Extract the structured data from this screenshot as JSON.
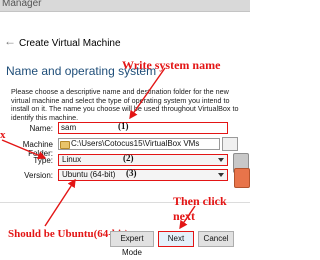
{
  "window": {
    "caption": "Manager"
  },
  "dialog": {
    "title": "Create Virtual Machine",
    "section_heading": "Name and operating system",
    "description": "Please choose a descriptive name and destination folder for the new virtual machine and select the type of operating system you intend to install on it. The name you choose will be used throughout VirtualBox to identify this machine."
  },
  "form": {
    "name_label": "Name:",
    "name_value": "sam",
    "folder_label": "Machine Folder:",
    "folder_value": "C:\\Users\\Cotocus15\\VirtualBox VMs",
    "type_label": "Type:",
    "type_value": "Linux",
    "version_label": "Version:",
    "version_value": "Ubuntu (64-bit)"
  },
  "annotations": {
    "write_name": "Write system name",
    "should_be": "Should be Ubuntu(64-bit)",
    "then_click": "Then click next",
    "side_mark": "x",
    "marker_1": "(1)",
    "marker_2": "(2)",
    "marker_3": "(3)"
  },
  "buttons": {
    "expert": "Expert Mode",
    "next": "Next",
    "cancel": "Cancel"
  },
  "colors": {
    "annotation_red": "#e31515",
    "heading_blue": "#1f4e79"
  }
}
